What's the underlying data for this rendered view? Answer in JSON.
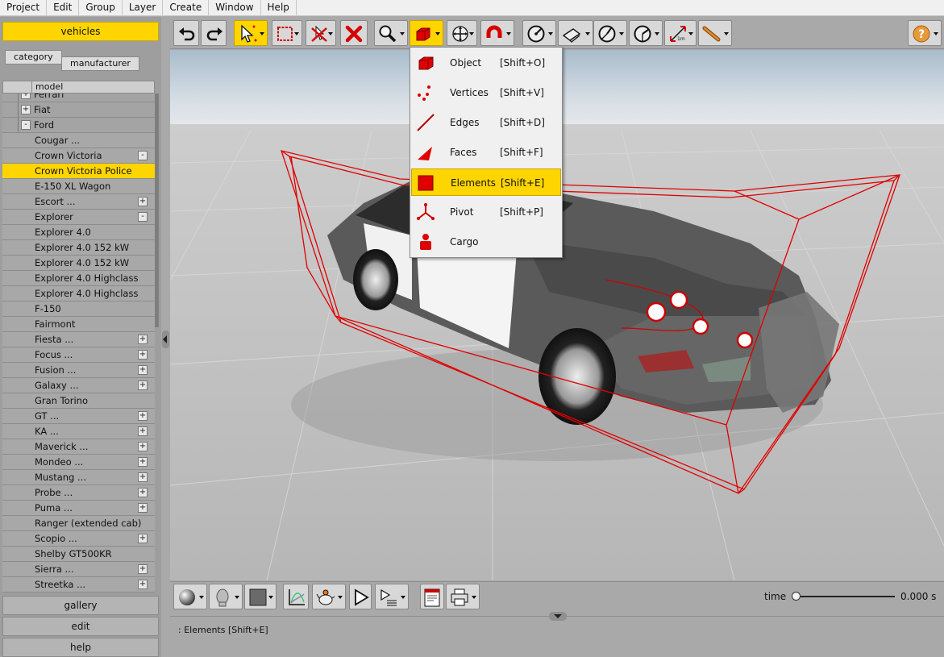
{
  "menubar": {
    "items": [
      "Project",
      "Edit",
      "Group",
      "Layer",
      "Create",
      "Window",
      "Help"
    ]
  },
  "left": {
    "vehicles": "vehicles",
    "tab_category": "category",
    "tab_manufacturer": "manufacturer",
    "column": "model",
    "brands": [
      "Ferrari",
      "Fiat",
      "Ford"
    ],
    "models": [
      "Cougar ...",
      "Crown Victoria",
      "Crown Victoria Police",
      "E-150 XL Wagon",
      "Escort ...",
      "Explorer",
      "Explorer 4.0",
      "Explorer 4.0 152 kW",
      "Explorer 4.0 152 kW",
      "Explorer 4.0 Highclass",
      "Explorer 4.0 Highclass",
      "F-150",
      "Fairmont",
      "Fiesta ...",
      "Focus ...",
      "Fusion ...",
      "Galaxy ...",
      "Gran Torino",
      "GT ...",
      "KA ...",
      "Maverick ...",
      "Mondeo ...",
      "Mustang ...",
      "Probe ...",
      "Puma ...",
      "Ranger (extended cab)",
      "Scopio ...",
      "Shelby GT500KR",
      "Sierra ...",
      "Streetka ..."
    ],
    "gallery": "gallery",
    "edit": "edit",
    "help": "help"
  },
  "dropdown": {
    "items": [
      {
        "name": "Object",
        "shortcut": "[Shift+O]"
      },
      {
        "name": "Vertices",
        "shortcut": "[Shift+V]"
      },
      {
        "name": "Edges",
        "shortcut": "[Shift+D]"
      },
      {
        "name": "Faces",
        "shortcut": "[Shift+F]"
      },
      {
        "name": "Elements",
        "shortcut": "[Shift+E]"
      },
      {
        "name": "Pivot",
        "shortcut": "[Shift+P]"
      },
      {
        "name": "Cargo",
        "shortcut": ""
      }
    ]
  },
  "timeline": {
    "label": "time",
    "value": "0.000 s"
  },
  "status": {
    "text": ": Elements [Shift+E]"
  },
  "colors": {
    "accent": "#ffd500",
    "bbox": "#e00000"
  }
}
